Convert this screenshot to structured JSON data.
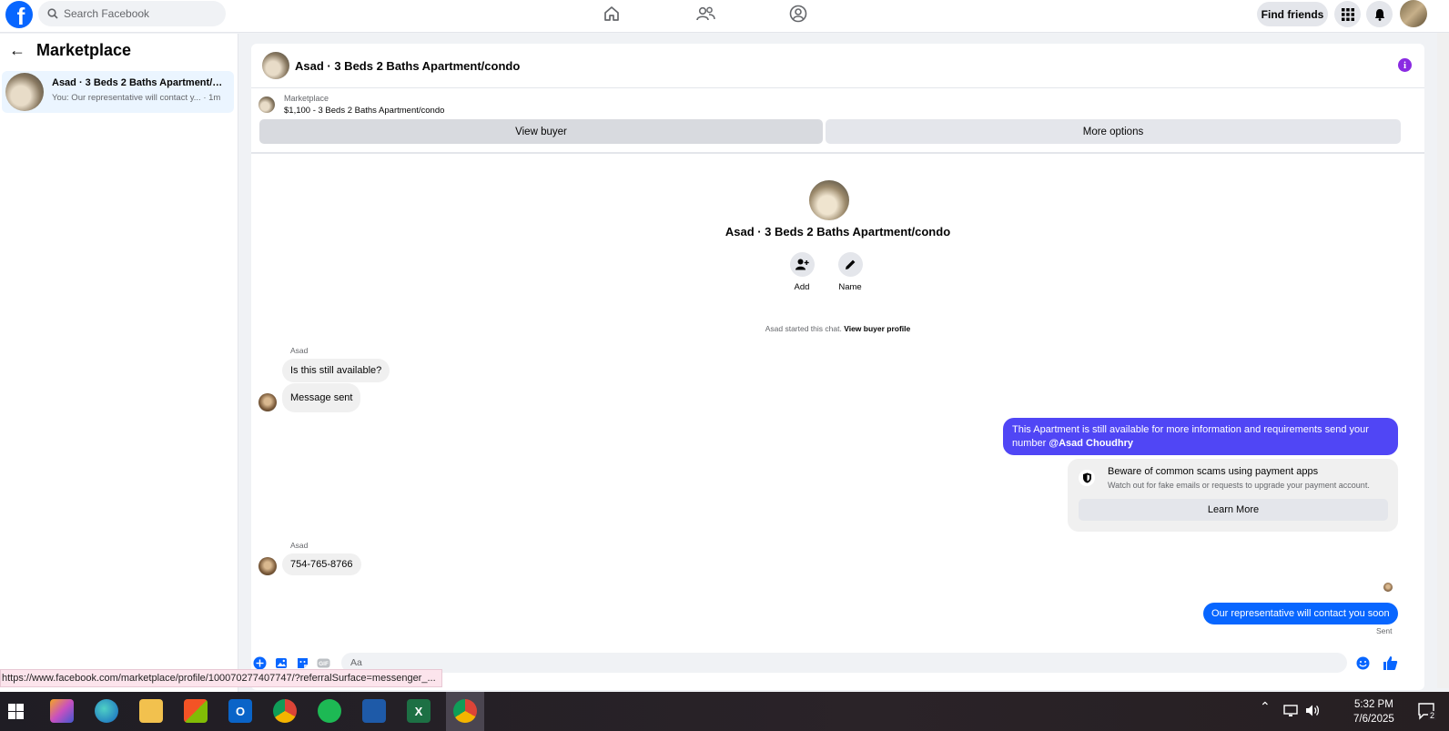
{
  "topbar": {
    "logo_letter": "f",
    "search_placeholder": "Search Facebook",
    "find_friends": "Find friends"
  },
  "sidebar": {
    "title": "Marketplace",
    "conversation": {
      "title": "Asad · 3 Beds 2 Baths Apartment/c...",
      "preview": "You: Our representative will contact y... · 1m"
    }
  },
  "chat": {
    "header_title": "Asad · 3 Beds 2 Baths Apartment/condo",
    "listing": {
      "category": "Marketplace",
      "price_title": "$1,100 - 3 Beds 2 Baths Apartment/condo"
    },
    "buttons": {
      "view_buyer": "View buyer",
      "more_options": "More options"
    },
    "center_title": "Asad · 3 Beds 2 Baths Apartment/condo",
    "actions": {
      "add": "Add",
      "name": "Name"
    },
    "started_text": "Asad started this chat.",
    "view_buyer_profile": "View buyer profile",
    "messages": {
      "sender1": "Asad",
      "msg1": "Is this still available?",
      "msg2": "Message sent",
      "out1_text": "This Apartment is still available for more information and requirements send your number ",
      "out1_mention": "@Asad Choudhry",
      "scam_title": "Beware of common scams using payment apps",
      "scam_sub": "Watch out for fake emails or requests to upgrade your payment account.",
      "learn_more": "Learn More",
      "sender2": "Asad",
      "msg3": "754-765-8766",
      "out2": "Our representative will contact you soon",
      "sent": "Sent"
    },
    "composer_placeholder": "Aa"
  },
  "status_url": "https://www.facebook.com/marketplace/profile/100070277407747/?referralSurface=messenger_...",
  "taskbar": {
    "time": "5:32 PM",
    "date": "7/6/2025",
    "notif_count": "2"
  },
  "colors": {
    "brand": "#0866ff",
    "outgoing_bubble": "#5046f5",
    "info_icon": "#8a2be2"
  }
}
